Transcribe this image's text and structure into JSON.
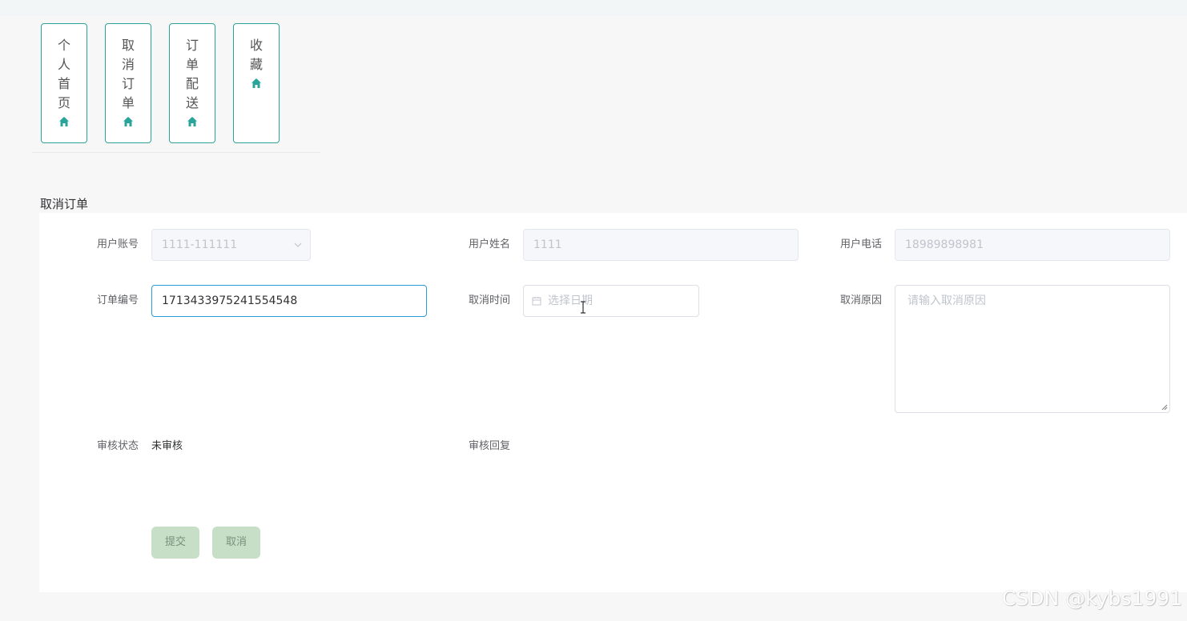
{
  "nav": {
    "items": [
      {
        "label": "个人首页",
        "icon": "home-icon"
      },
      {
        "label": "取消订单",
        "icon": "home-icon"
      },
      {
        "label": "订单配送",
        "icon": "home-icon"
      },
      {
        "label": "收藏",
        "icon": "home-icon"
      }
    ]
  },
  "section": {
    "title": "取消订单"
  },
  "form": {
    "account": {
      "label": "用户账号",
      "value": "1111-111111"
    },
    "name": {
      "label": "用户姓名",
      "value": "1111"
    },
    "phone": {
      "label": "用户电话",
      "value": "18989898981"
    },
    "order_no": {
      "label": "订单编号",
      "value": "1713433975241554548"
    },
    "cancel_time": {
      "label": "取消时间",
      "placeholder": "选择日期"
    },
    "reason": {
      "label": "取消原因",
      "placeholder": "请输入取消原因"
    },
    "status": {
      "label": "审核状态",
      "value": "未审核"
    },
    "reply": {
      "label": "审核回复",
      "value": ""
    }
  },
  "buttons": {
    "submit": "提交",
    "cancel": "取消"
  },
  "colors": {
    "accent": "#2aa39a",
    "button_bg": "#c6dfc6",
    "focus_border": "#2a9fd6"
  },
  "watermark": "CSDN @kybs1991"
}
